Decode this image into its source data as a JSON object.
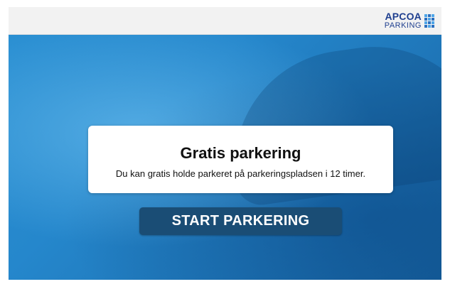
{
  "header": {
    "logo": {
      "line1": "APCOA",
      "line2": "PARKING",
      "icon": "apcoa-grid-logo-icon"
    }
  },
  "hero": {
    "card": {
      "title": "Gratis parkering",
      "text": "Du kan gratis holde parkeret på parkeringspladsen i 12 timer."
    },
    "start_button_label": "START PARKERING"
  },
  "colors": {
    "brand": "#1f3f8f",
    "hero_blue": "#2587cc",
    "button": "#1a4d75"
  }
}
